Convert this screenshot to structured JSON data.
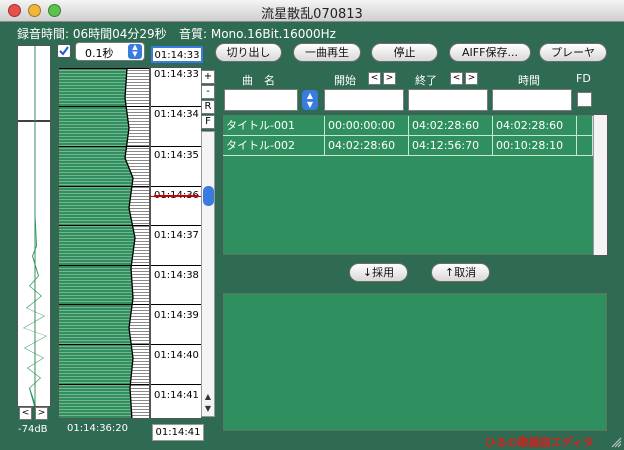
{
  "window": {
    "title": "流星散乱070813",
    "footer_text": "ひるの歌謡曲エディタ"
  },
  "info": {
    "rec_time": "録音時間: 06時間04分29秒",
    "quality": "音質: Mono.16Bit.16000Hz"
  },
  "controls": {
    "step_checked": true,
    "step_value": "0.1秒",
    "current_time": "01:14:33",
    "cut_button": "切り出し",
    "play_one_button": "一曲再生",
    "stop_button": "停止",
    "aiff_save_button": "AIFF保存...",
    "player_button": "プレーヤ"
  },
  "meter": {
    "db_label": "-74dB"
  },
  "timeline": {
    "ticks": [
      "01:14:33",
      "01:14:34",
      "01:14:35",
      "01:14:36",
      "01:14:37",
      "01:14:38",
      "01:14:39",
      "01:14:40",
      "01:14:41"
    ],
    "start_label": "01:14:36:20",
    "end_label": "01:14:41",
    "side_buttons": [
      "+",
      "-",
      "R",
      "F"
    ]
  },
  "table": {
    "headers": {
      "title": "曲　名",
      "start": "開始",
      "end": "終了",
      "duration": "時間",
      "fd": "FD"
    },
    "rows": [
      {
        "title": "タイトル-001",
        "start": "00:00:00:00",
        "end": "04:02:28:60",
        "duration": "04:02:28:60"
      },
      {
        "title": "タイトル-002",
        "start": "04:02:28:60",
        "end": "04:12:56:70",
        "duration": "00:10:28:10"
      }
    ]
  },
  "actions": {
    "adopt_button": "↓採用",
    "cancel_button": "↑取消"
  },
  "colors": {
    "background": "#2f6a52",
    "table_bg": "#2f8f5f",
    "footer_red": "#d2201a"
  }
}
